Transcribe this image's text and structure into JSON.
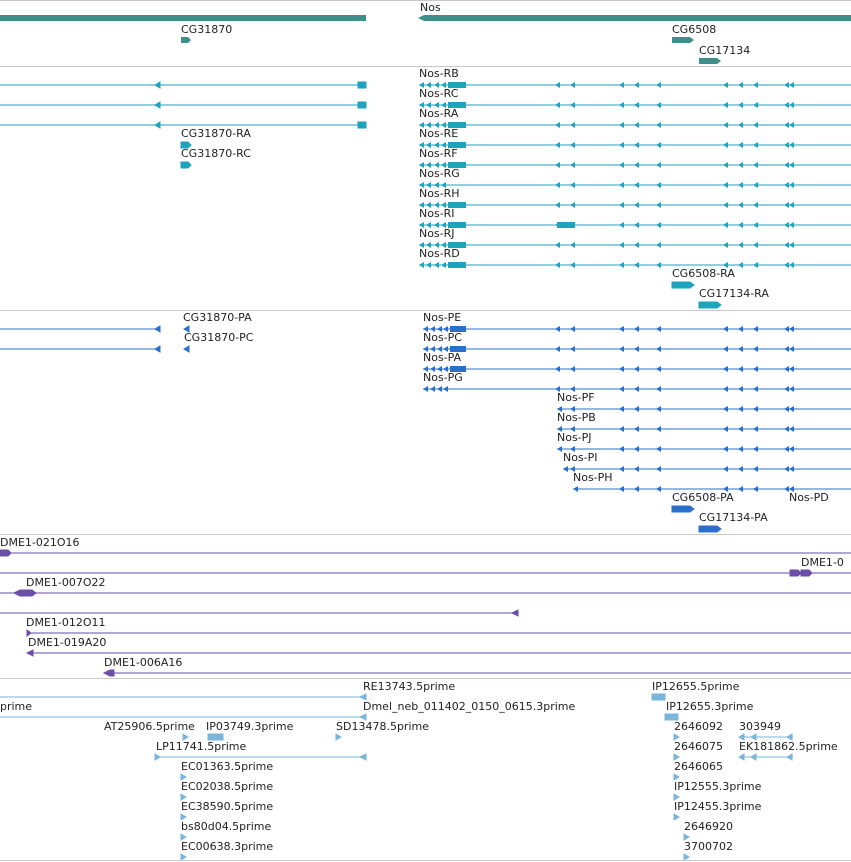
{
  "colors": {
    "gene": "#3e8f8a",
    "transcript": "#1ea3bd",
    "protein": "#2a6fc9",
    "cdna": "#6a4ea8",
    "est": "#7ab6dc",
    "separator": "#c9c9c9"
  },
  "tracks": {
    "genes": {
      "features": [
        {
          "name": "Nos"
        },
        {
          "name": "CG31870"
        },
        {
          "name": "CG6508"
        },
        {
          "name": "CG17134"
        }
      ]
    },
    "transcripts": {
      "features": [
        {
          "name": "Nos-RB"
        },
        {
          "name": "Nos-RC"
        },
        {
          "name": "Nos-RA"
        },
        {
          "name": "CG31870-RA"
        },
        {
          "name": "Nos-RE"
        },
        {
          "name": "CG31870-RC"
        },
        {
          "name": "Nos-RF"
        },
        {
          "name": "Nos-RG"
        },
        {
          "name": "Nos-RH"
        },
        {
          "name": "Nos-RI"
        },
        {
          "name": "Nos-RJ"
        },
        {
          "name": "Nos-RD"
        },
        {
          "name": "CG6508-RA"
        },
        {
          "name": "CG17134-RA"
        }
      ]
    },
    "proteins": {
      "features": [
        {
          "name": "CG31870-PA"
        },
        {
          "name": "Nos-PE"
        },
        {
          "name": "CG31870-PC"
        },
        {
          "name": "Nos-PC"
        },
        {
          "name": "Nos-PA"
        },
        {
          "name": "Nos-PG"
        },
        {
          "name": "Nos-PF"
        },
        {
          "name": "Nos-PB"
        },
        {
          "name": "Nos-PJ"
        },
        {
          "name": "Nos-PI"
        },
        {
          "name": "Nos-PH"
        },
        {
          "name": "CG6508-PA"
        },
        {
          "name": "Nos-PD"
        },
        {
          "name": "CG17134-PA"
        }
      ]
    },
    "cdna_clones": {
      "features": [
        {
          "name": "DME1-021O16"
        },
        {
          "name": "DME1-0"
        },
        {
          "name": "DME1-007O22"
        },
        {
          "name": "DME1-012O11"
        },
        {
          "name": "DME1-019A20"
        },
        {
          "name": "DME1-006A16"
        }
      ]
    },
    "ests": {
      "features": [
        {
          "name": "RE13743.5prime"
        },
        {
          "name": "IP12655.5prime"
        },
        {
          "name": "prime"
        },
        {
          "name": "Dmel_neb_011402_0150_0615.3prime"
        },
        {
          "name": "IP12655.3prime"
        },
        {
          "name": "AT25906.5prime"
        },
        {
          "name": "IP03749.3prime"
        },
        {
          "name": "SD13478.5prime"
        },
        {
          "name": "2646092"
        },
        {
          "name": "303949"
        },
        {
          "name": "LP11741.5prime"
        },
        {
          "name": "2646075"
        },
        {
          "name": "EK181862.5prime"
        },
        {
          "name": "EC01363.5prime"
        },
        {
          "name": "2646065"
        },
        {
          "name": "EC02038.5prime"
        },
        {
          "name": "IP12555.3prime"
        },
        {
          "name": "EC38590.5prime"
        },
        {
          "name": "IP12455.3prime"
        },
        {
          "name": "bs80d04.5prime"
        },
        {
          "name": "2646920"
        },
        {
          "name": "EC00638.3prime"
        },
        {
          "name": "3700702"
        }
      ]
    }
  }
}
